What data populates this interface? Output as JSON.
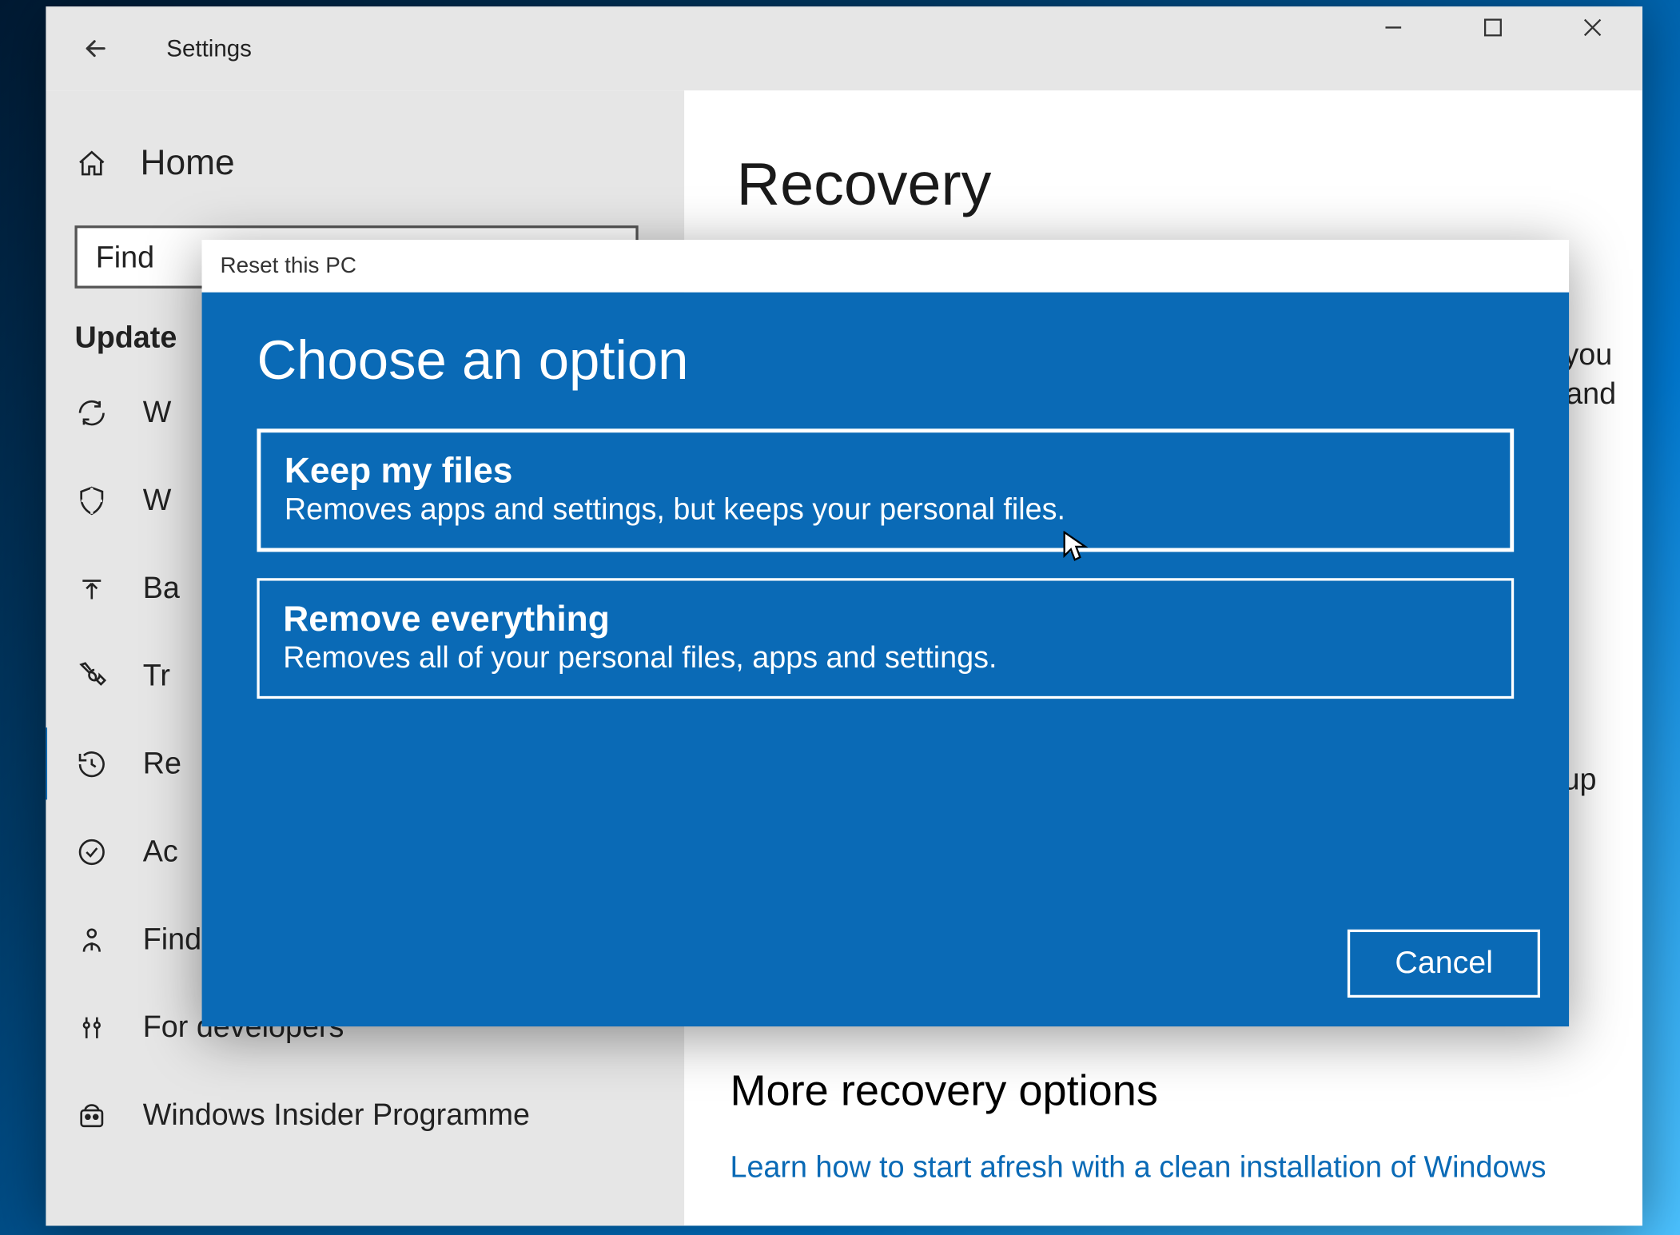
{
  "window": {
    "app_title": "Settings"
  },
  "sidebar": {
    "home_label": "Home",
    "search_value": "Find",
    "search_placeholder": "Find a setting",
    "group_label": "Update",
    "items": [
      {
        "label": "W",
        "icon": "sync"
      },
      {
        "label": "W",
        "icon": "shield"
      },
      {
        "label": "Ba",
        "icon": "backup"
      },
      {
        "label": "Tr",
        "icon": "wrench"
      },
      {
        "label": "Re",
        "icon": "history",
        "active": true
      },
      {
        "label": "Ac",
        "icon": "check-circle"
      },
      {
        "label": "Find my device",
        "icon": "person-pin"
      },
      {
        "label": "For developers",
        "icon": "developer"
      },
      {
        "label": "Windows Insider Programme",
        "icon": "insider"
      }
    ]
  },
  "content": {
    "page_title": "Recovery",
    "hint_frag1": "you",
    "hint_frag2": "and",
    "hint_frag3": "up",
    "section_head": "More recovery options",
    "learn_link": "Learn how to start afresh with a clean installation of Windows"
  },
  "modal": {
    "title": "Reset this PC",
    "heading": "Choose an option",
    "options": [
      {
        "title": "Keep my files",
        "desc": "Removes apps and settings, but keeps your personal files."
      },
      {
        "title": "Remove everything",
        "desc": "Removes all of your personal files, apps and settings."
      }
    ],
    "cancel_label": "Cancel"
  }
}
